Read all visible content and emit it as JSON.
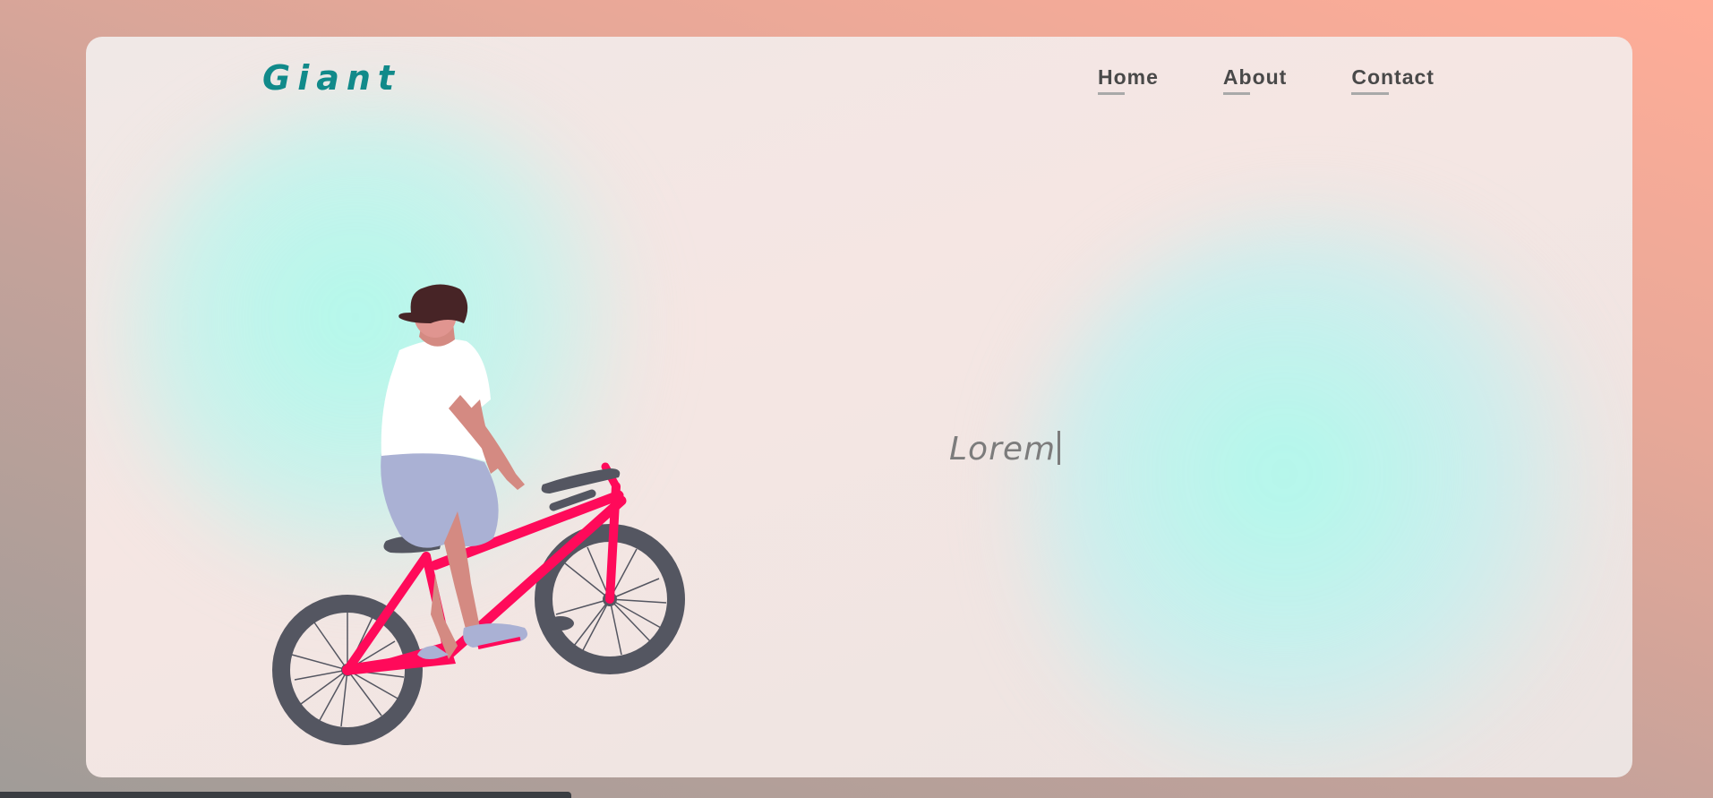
{
  "header": {
    "logo": "Giant",
    "nav": [
      {
        "label": "Home"
      },
      {
        "label": "About"
      },
      {
        "label": "Contact"
      }
    ]
  },
  "hero": {
    "text": "Lorem"
  },
  "colors": {
    "logo": "#118a8a",
    "nav_text": "#494949",
    "bike_frame": "#ff0a5a",
    "wheel": "#545661",
    "blob": "#acfaeb"
  },
  "icons": [
    "bicycle-rider-illustration"
  ]
}
